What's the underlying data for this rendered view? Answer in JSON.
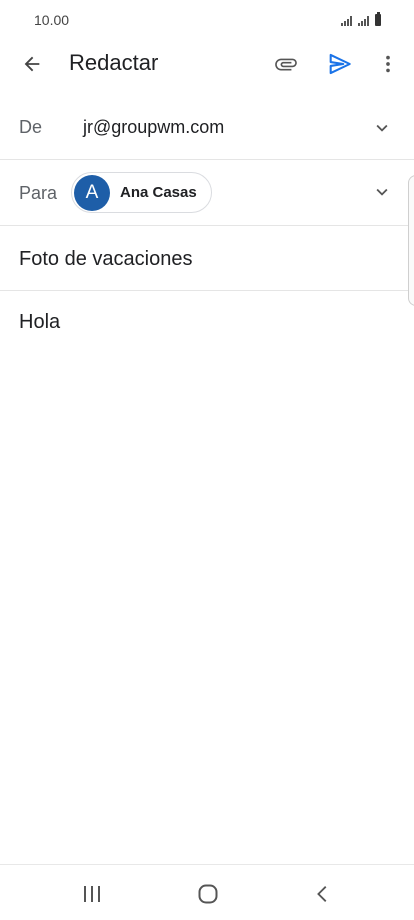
{
  "status_bar": {
    "time": "10.00"
  },
  "app_bar": {
    "title": "Redactar"
  },
  "compose": {
    "from_label": "De",
    "from_value": "jr@groupwm.com",
    "to_label": "Para",
    "to_recipients": [
      {
        "initial": "A",
        "name": "Ana Casas",
        "avatar_color": "#1e5ea8"
      }
    ],
    "subject": "Foto de vacaciones",
    "body": "Hola"
  },
  "icons": {
    "back": "arrow-back-icon",
    "attach": "paperclip-icon",
    "send": "send-icon",
    "more": "more-vert-icon",
    "expand": "chevron-down-icon",
    "nav_recents": "recents-icon",
    "nav_home": "home-icon",
    "nav_back": "nav-back-icon"
  },
  "colors": {
    "accent": "#1a73e8",
    "avatar": "#1e5ea8"
  }
}
